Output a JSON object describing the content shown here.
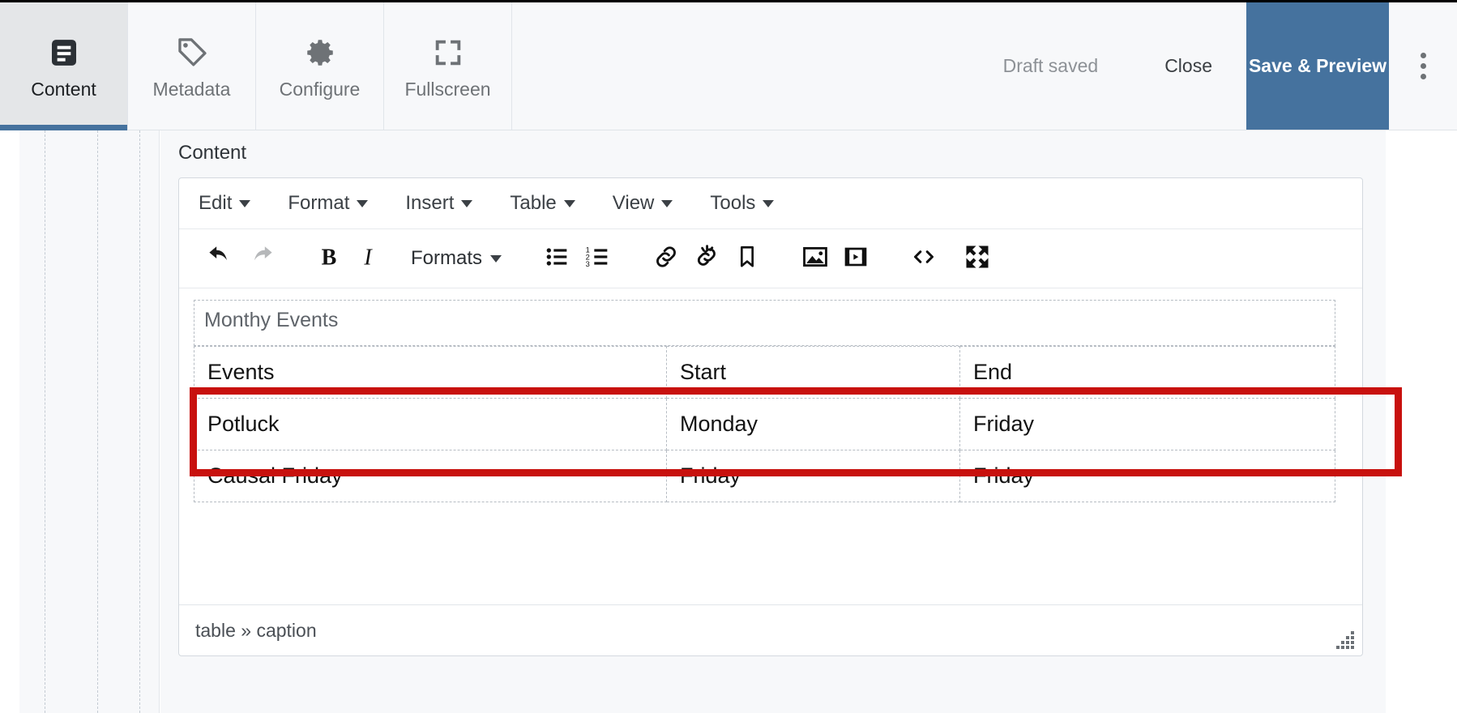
{
  "header": {
    "tabs": [
      {
        "label": "Content",
        "icon": "document-lines-icon",
        "active": true
      },
      {
        "label": "Metadata",
        "icon": "tag-icon",
        "active": false
      },
      {
        "label": "Configure",
        "icon": "gear-icon",
        "active": false
      },
      {
        "label": "Fullscreen",
        "icon": "expand-corners-icon",
        "active": false
      }
    ],
    "draft_status": "Draft saved",
    "close_label": "Close",
    "save_preview_label": "Save & Preview",
    "overflow_icon": "kebab-menu-icon",
    "accent_color": "#45729e",
    "active_tab_bg": "#e4e6e8"
  },
  "page": {
    "content_label": "Content"
  },
  "editor": {
    "menus": [
      {
        "label": "Edit"
      },
      {
        "label": "Format"
      },
      {
        "label": "Insert"
      },
      {
        "label": "Table"
      },
      {
        "label": "View"
      },
      {
        "label": "Tools"
      }
    ],
    "toolbar": [
      {
        "name": "undo-icon",
        "title": "Undo",
        "disabled": false
      },
      {
        "name": "redo-icon",
        "title": "Redo",
        "disabled": true
      },
      {
        "name": "bold-icon",
        "title": "Bold",
        "disabled": false
      },
      {
        "name": "italic-icon",
        "title": "Italic",
        "disabled": false
      },
      {
        "name": "formats-dropdown",
        "title": "Formats",
        "disabled": false
      },
      {
        "name": "bullet-list-icon",
        "title": "Bullet list",
        "disabled": false
      },
      {
        "name": "numbered-list-icon",
        "title": "Numbered list",
        "disabled": false
      },
      {
        "name": "link-icon",
        "title": "Insert link",
        "disabled": false
      },
      {
        "name": "unlink-icon",
        "title": "Remove link",
        "disabled": false
      },
      {
        "name": "anchor-icon",
        "title": "Anchor",
        "disabled": false
      },
      {
        "name": "image-icon",
        "title": "Insert image",
        "disabled": false
      },
      {
        "name": "media-icon",
        "title": "Insert media",
        "disabled": false
      },
      {
        "name": "source-code-icon",
        "title": "Source code",
        "disabled": false
      },
      {
        "name": "fullscreen-icon",
        "title": "Fullscreen",
        "disabled": false
      }
    ],
    "formats_label": "Formats",
    "table": {
      "caption": "Monthy Events",
      "rows": [
        [
          "Events",
          "Start",
          "End"
        ],
        [
          "Potluck",
          "Monday",
          "Friday"
        ],
        [
          "Causal Friday",
          "Friday",
          "Friday"
        ]
      ]
    },
    "statusbar": {
      "path": "table » caption",
      "resize_icon": "resize-grip-icon"
    }
  },
  "annotation": {
    "highlight_color": "#c8110e",
    "target": "table-caption-row"
  }
}
